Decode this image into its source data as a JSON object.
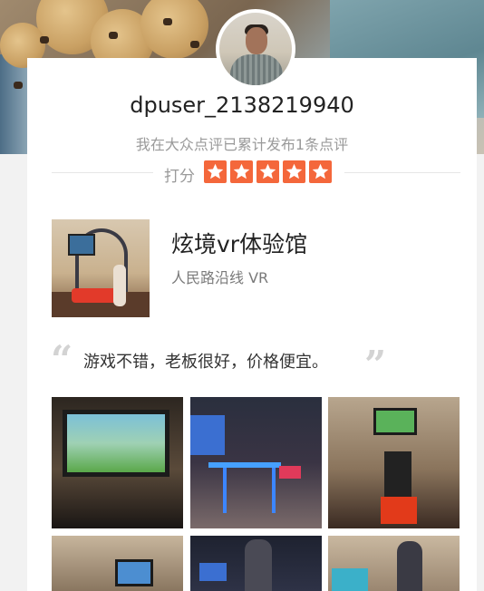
{
  "user": {
    "name": "dpuser_2138219940",
    "summary": "我在大众点评已累计发布1条点评"
  },
  "rating": {
    "label": "打分",
    "stars": 5,
    "star_color": "#f4673b"
  },
  "shop": {
    "name": "炫境vr体验馆",
    "meta": "人民路沿线 VR"
  },
  "review": {
    "text": "游戏不错，老板很好，价格便宜。"
  },
  "photos": {
    "count_visible": 6
  }
}
